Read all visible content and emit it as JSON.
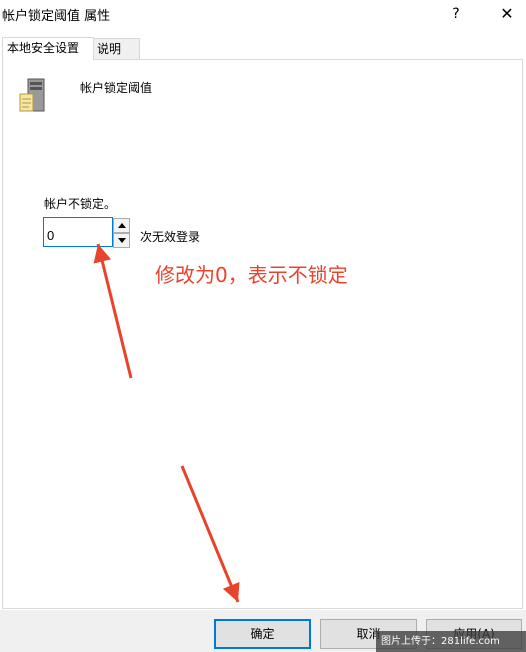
{
  "window": {
    "title": "帐户锁定阈值 属性",
    "help_label": "?",
    "close_label": "✕"
  },
  "tabs": [
    {
      "label": "本地安全设置",
      "active": true
    },
    {
      "label": "说明",
      "active": false
    }
  ],
  "policy": {
    "icon": "server-icon",
    "name": "帐户锁定阈值"
  },
  "threshold": {
    "label": "帐户不锁定。",
    "value": "0",
    "suffix": "次无效登录"
  },
  "annotation": {
    "text": "修改为0，表示不锁定",
    "color": "#e8442d"
  },
  "buttons": {
    "ok": "确定",
    "cancel": "取消",
    "apply": "应用(A)"
  },
  "watermark": "图片上传于：281life.com",
  "colors": {
    "focus_border": "#0078d7",
    "annotation": "#e8442d",
    "footer_bg": "#f0f0f0"
  }
}
